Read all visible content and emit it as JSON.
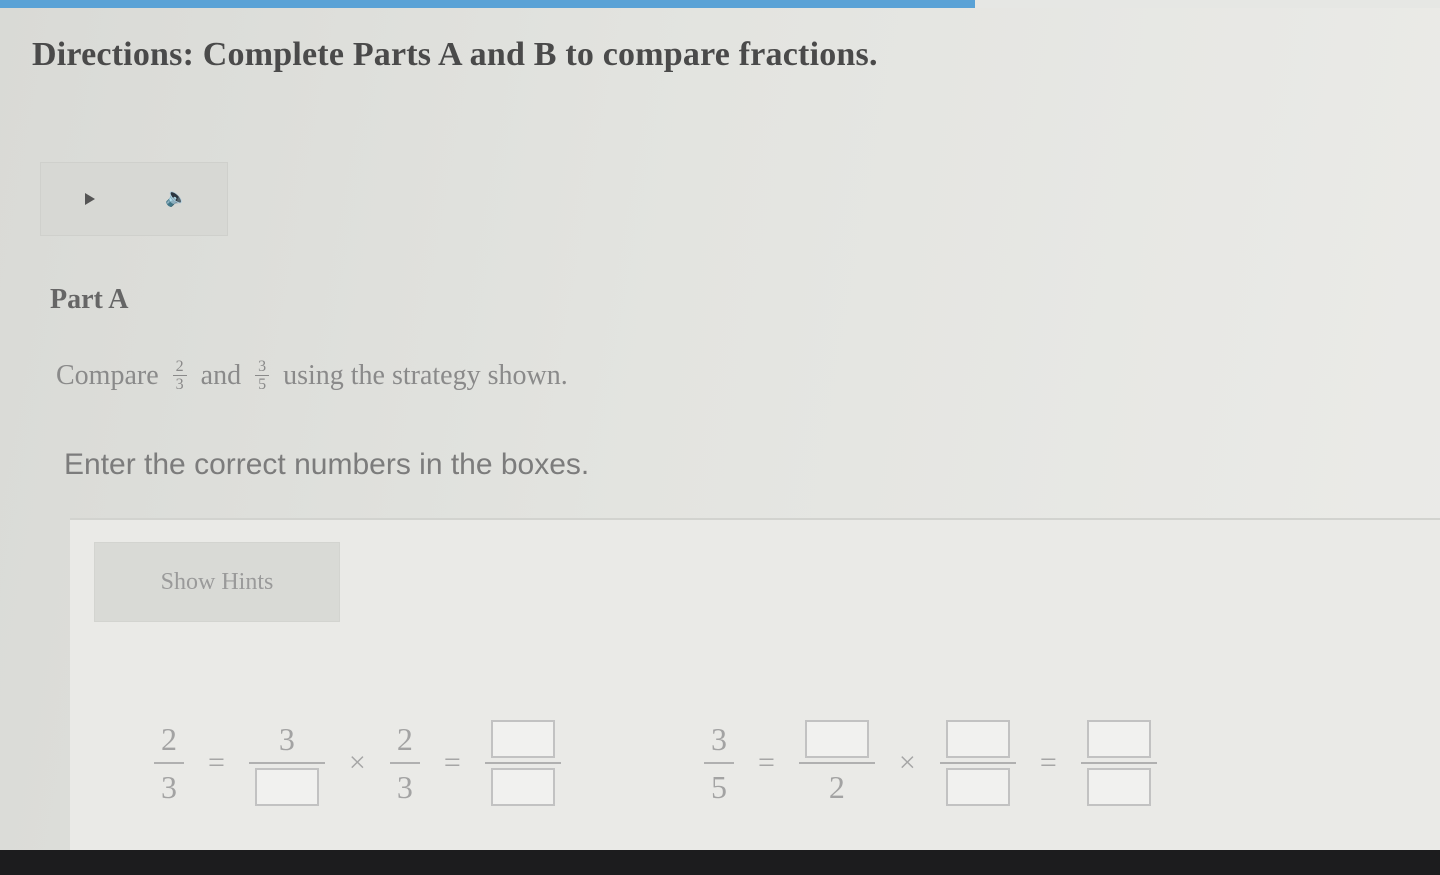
{
  "progress": {
    "fraction": 0.677,
    "fill_color": "#5aa2d6"
  },
  "header": {
    "directions": "Directions: Complete Parts A and B to compare fractions."
  },
  "audio": {
    "play_icon": "play-icon",
    "speaker_icon": "speaker-icon"
  },
  "part": {
    "label": "Part A",
    "compare_word": "Compare",
    "fraction1": {
      "num": "2",
      "den": "3"
    },
    "and_word": "and",
    "fraction2": {
      "num": "3",
      "den": "5"
    },
    "strategy_text": "using the strategy shown.",
    "instruction": "Enter the correct numbers in the boxes."
  },
  "hints": {
    "label": "Show Hints"
  },
  "equations": {
    "eq1": {
      "lhs": {
        "num": "2",
        "den": "3"
      },
      "eq_sign": "=",
      "multiplier": {
        "num": "3",
        "den_value": ""
      },
      "times_sign": "×",
      "factor": {
        "num": "2",
        "den": "3"
      },
      "eq_sign2": "=",
      "result": {
        "num_value": "",
        "den_value": ""
      }
    },
    "eq2": {
      "lhs": {
        "num": "3",
        "den": "5"
      },
      "eq_sign": "=",
      "multiplier": {
        "num_value": "",
        "den": "2"
      },
      "times_sign": "×",
      "factor": {
        "num_value": "",
        "den_value": ""
      },
      "eq_sign2": "=",
      "result": {
        "num_value": "",
        "den_value": ""
      }
    }
  }
}
